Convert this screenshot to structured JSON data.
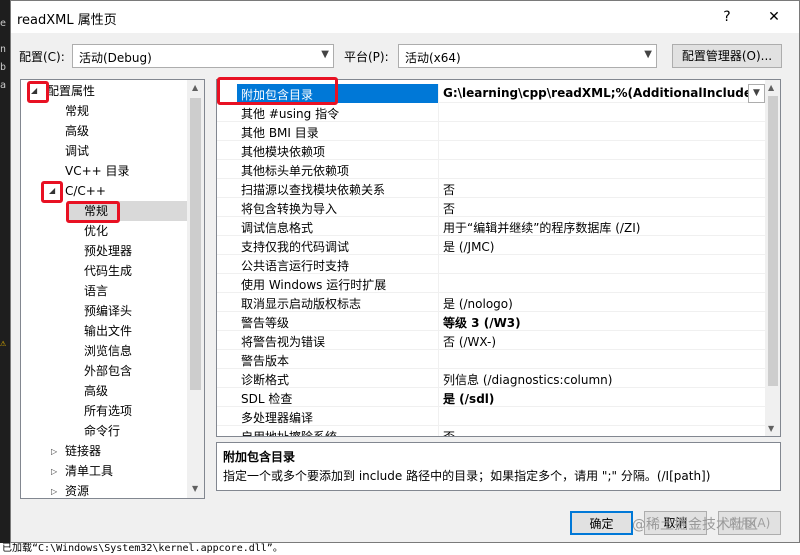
{
  "background": {
    "left_glyphs": [
      "e",
      "n",
      "b",
      "a"
    ],
    "warn_glyph": "⚠",
    "bottom_text": "已加载“C:\\Windows\\System32\\kernel.appcore.dll”。"
  },
  "dialog": {
    "title": "readXML 属性页",
    "help": "?",
    "close": "✕"
  },
  "config": {
    "config_label": "配置(C):",
    "config_value": "活动(Debug)",
    "platform_label": "平台(P):",
    "platform_value": "活动(x64)",
    "manager_button": "配置管理器(O)..."
  },
  "tree": {
    "root": "配置属性",
    "general": "常规",
    "advanced": "高级",
    "debugging": "调试",
    "vc_dirs": "VC++ 目录",
    "cpp": "C/C++",
    "cpp_children": [
      "常规",
      "优化",
      "预处理器",
      "代码生成",
      "语言",
      "预编译头",
      "输出文件",
      "浏览信息",
      "外部包含",
      "高级",
      "所有选项",
      "命令行"
    ],
    "linker": "链接器",
    "manifest": "清单工具",
    "resources": "资源"
  },
  "properties": [
    {
      "name": "附加包含目录",
      "value": "G:\\learning\\cpp\\readXML;%(AdditionalIncludeDir",
      "bold": true
    },
    {
      "name": "其他 #using 指令",
      "value": "",
      "bold": false
    },
    {
      "name": "其他 BMI 目录",
      "value": "",
      "bold": false
    },
    {
      "name": "其他模块依赖项",
      "value": "",
      "bold": false
    },
    {
      "name": "其他标头单元依赖项",
      "value": "",
      "bold": false
    },
    {
      "name": "扫描源以查找模块依赖关系",
      "value": "否",
      "bold": false
    },
    {
      "name": "将包含转换为导入",
      "value": "否",
      "bold": false
    },
    {
      "name": "调试信息格式",
      "value": "用于“编辑并继续”的程序数据库 (/ZI)",
      "bold": false
    },
    {
      "name": "支持仅我的代码调试",
      "value": "是 (/JMC)",
      "bold": false
    },
    {
      "name": "公共语言运行时支持",
      "value": "",
      "bold": false
    },
    {
      "name": "使用 Windows 运行时扩展",
      "value": "",
      "bold": false
    },
    {
      "name": "取消显示启动版权标志",
      "value": "是 (/nologo)",
      "bold": false
    },
    {
      "name": "警告等级",
      "value": "等级 3 (/W3)",
      "bold": true
    },
    {
      "name": "将警告视为错误",
      "value": "否 (/WX-)",
      "bold": false
    },
    {
      "name": "警告版本",
      "value": "",
      "bold": false
    },
    {
      "name": "诊断格式",
      "value": "列信息 (/diagnostics:column)",
      "bold": false
    },
    {
      "name": "SDL 检查",
      "value": "是 (/sdl)",
      "bold": true
    },
    {
      "name": "多处理器编译",
      "value": "",
      "bold": false
    },
    {
      "name": "启用地址擦除系统",
      "value": "否",
      "bold": false
    }
  ],
  "description": {
    "title": "附加包含目录",
    "text": "指定一个或多个要添加到 include 路径中的目录；如果指定多个，请用 \";\" 分隔。(/I[path])"
  },
  "buttons": {
    "ok": "确定",
    "cancel": "取消",
    "apply": "应用(A)"
  },
  "watermark": "@稀土掘金技术社区"
}
